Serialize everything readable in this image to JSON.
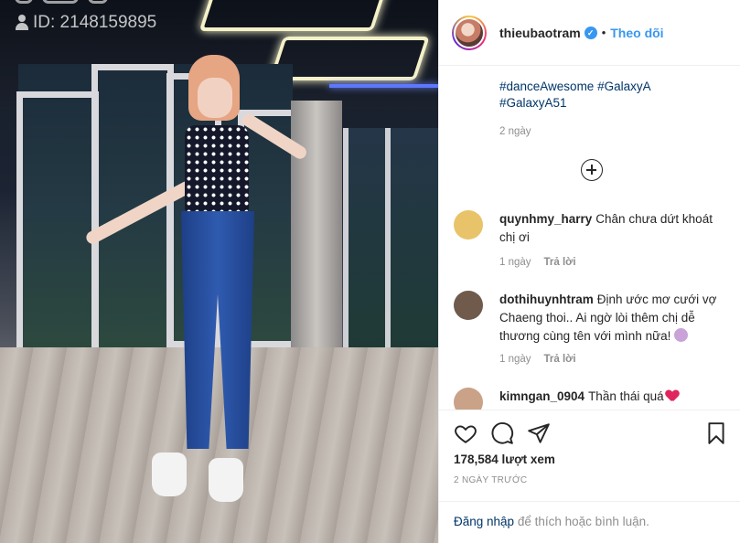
{
  "video": {
    "watermark_id": "ID: 2148159895"
  },
  "post": {
    "username": "thieubaotram",
    "verified_mark": "✓",
    "separator": "•",
    "follow_label": "Theo dõi",
    "caption_tags": [
      "#danceAwesome",
      "#GalaxyA",
      "#GalaxyA51"
    ],
    "caption_age": "2 ngày"
  },
  "comments": [
    {
      "user": "quynhmy_harry",
      "text": "Chân chưa dứt khoát chị ơi",
      "age": "1 ngày",
      "reply": "Trả lời",
      "avatar_color": "#e8c36a"
    },
    {
      "user": "dothihuynhtram",
      "text": "Định ước mơ cưới vợ Chaeng thoi.. Ai ngờ lòi thêm chị dễ thương cùng tên với mình nữa!",
      "age": "1 ngày",
      "reply": "Trả lời",
      "avatar_color": "#6f5a4c"
    },
    {
      "user": "kimngan_0904",
      "text": "Thần thái quá",
      "avatar_color": "#c9a287"
    }
  ],
  "actions": {
    "like_icon": "heart-outline",
    "comment_icon": "speech-bubble",
    "share_icon": "paper-plane",
    "save_icon": "bookmark",
    "views": "178,584 lượt xem",
    "date": "2 NGÀY TRƯỚC"
  },
  "login": {
    "link": "Đăng nhập",
    "rest": " để thích hoặc bình luận."
  },
  "colors": {
    "link_blue": "#003569",
    "follow_blue": "#3897f0",
    "muted": "#8e8e8e",
    "heart_red": "#e0245e"
  }
}
